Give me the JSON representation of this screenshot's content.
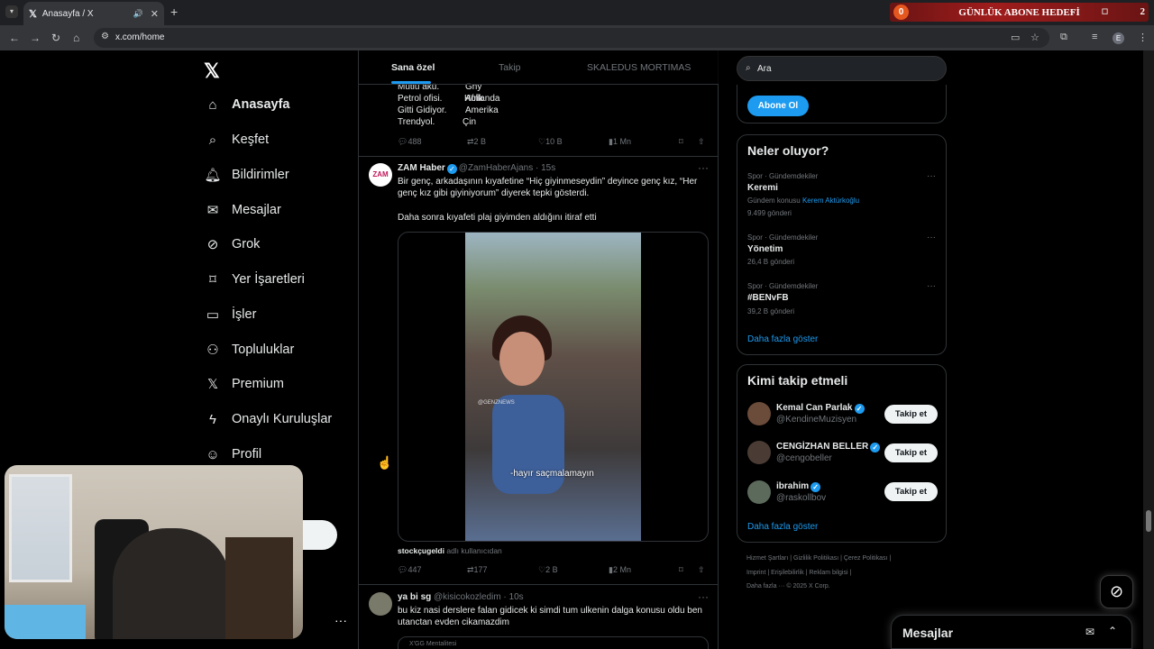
{
  "browser": {
    "tab_title": "Anasayfa / X",
    "url": "x.com/home"
  },
  "overlay": {
    "goal_label": "GÜNLÜK ABONE HEDEFİ",
    "current": "0",
    "target": "2"
  },
  "sidebar": {
    "items": [
      {
        "label": "Anasayfa",
        "icon": "home-icon"
      },
      {
        "label": "Keşfet",
        "icon": "search-icon"
      },
      {
        "label": "Bildirimler",
        "icon": "bell-icon"
      },
      {
        "label": "Mesajlar",
        "icon": "mail-icon"
      },
      {
        "label": "Grok",
        "icon": "grok-icon"
      },
      {
        "label": "Yer İşaretleri",
        "icon": "bookmark-icon"
      },
      {
        "label": "İşler",
        "icon": "briefcase-icon"
      },
      {
        "label": "Topluluklar",
        "icon": "people-icon"
      },
      {
        "label": "Premium",
        "icon": "x-icon"
      },
      {
        "label": "Onaylı Kuruluşlar",
        "icon": "lightning-icon"
      },
      {
        "label": "Profil",
        "icon": "user-icon"
      }
    ]
  },
  "feed_tabs": [
    "Sana özel",
    "Takip",
    "SKALEDUS MORTIMAS"
  ],
  "post1": {
    "lines": [
      [
        "Mutlu akü.",
        "Gny Afrik"
      ],
      [
        "Petrol ofisi.",
        "Hollanda"
      ],
      [
        "Gitti Gidiyor.",
        "Amerika"
      ],
      [
        "Trendyol.",
        "Çin"
      ]
    ],
    "replies": "488",
    "reposts": "2 B",
    "likes": "10 B",
    "views": "1 Mn"
  },
  "post2": {
    "name": "ZAM Haber",
    "handle": "@ZamHaberAjans",
    "time": "15s",
    "avatar_text": "ZAM",
    "text1": "Bir genç, arkadaşının kıyafetine “Hiç giyinmeseydin” deyince genç kız, “Her genç kız gibi giyiniyorum” diyerek tepki gösterdi.",
    "text2": "Daha sonra kıyafeti plaj giyimden aldığını itiraf etti",
    "caption": "-hayır saçmalamayın",
    "watermark": "@GENZNEWS",
    "source_user": "stockçugeldi",
    "source_suffix": "adlı kullanıcıdan",
    "replies": "447",
    "reposts": "177",
    "likes": "2 B",
    "views": "2 Mn"
  },
  "post3": {
    "name": "ya bi sg",
    "handle": "@kisicokozledim",
    "time": "10s",
    "text": "bu kiz nasi derslere falan gidicek ki simdi tum ulkenin dalga konusu oldu ben utanctan evden cikamazdim",
    "card_label": "X'GG Mentalitesi"
  },
  "right": {
    "search_placeholder": "Ara",
    "subscribe_label": "Abone Ol",
    "trends_title": "Neler oluyor?",
    "trends": [
      {
        "cat": "Spor · Gündemdekiler",
        "name": "Keremi",
        "meta_prefix": "Gündem konusu",
        "meta_link": "Kerem Aktürkoğlu",
        "count": "9.499 gönderi"
      },
      {
        "cat": "Spor · Gündemdekiler",
        "name": "Yönetim",
        "count": "26,4 B gönderi"
      },
      {
        "cat": "Spor · Gündemdekiler",
        "name": "#BENvFB",
        "count": "39,2 B gönderi"
      }
    ],
    "show_more": "Daha fazla göster",
    "who_title": "Kimi takip etmeli",
    "who": [
      {
        "name": "Kemal Can Parlak",
        "handle": "@KendineMuzisyen",
        "btn": "Takip et"
      },
      {
        "name": "CENGİZHAN BELLER",
        "handle": "@cengobeller",
        "btn": "Takip et"
      },
      {
        "name": "ibrahim",
        "handle": "@raskollbov",
        "btn": "Takip et"
      }
    ],
    "footer": {
      "l1": "Hizmet Şartları  |  Gizlilik Politikası  |  Çerez Politikası  |",
      "l2": "Imprint  |  Erişilebilirlik  |  Reklam bilgisi  |",
      "l3": "Daha fazla ···   © 2025 X Corp."
    }
  },
  "dm_label": "Mesajlar",
  "colors": {
    "accent": "#1d9bf0",
    "bg": "#000000",
    "border": "#2f3336"
  }
}
